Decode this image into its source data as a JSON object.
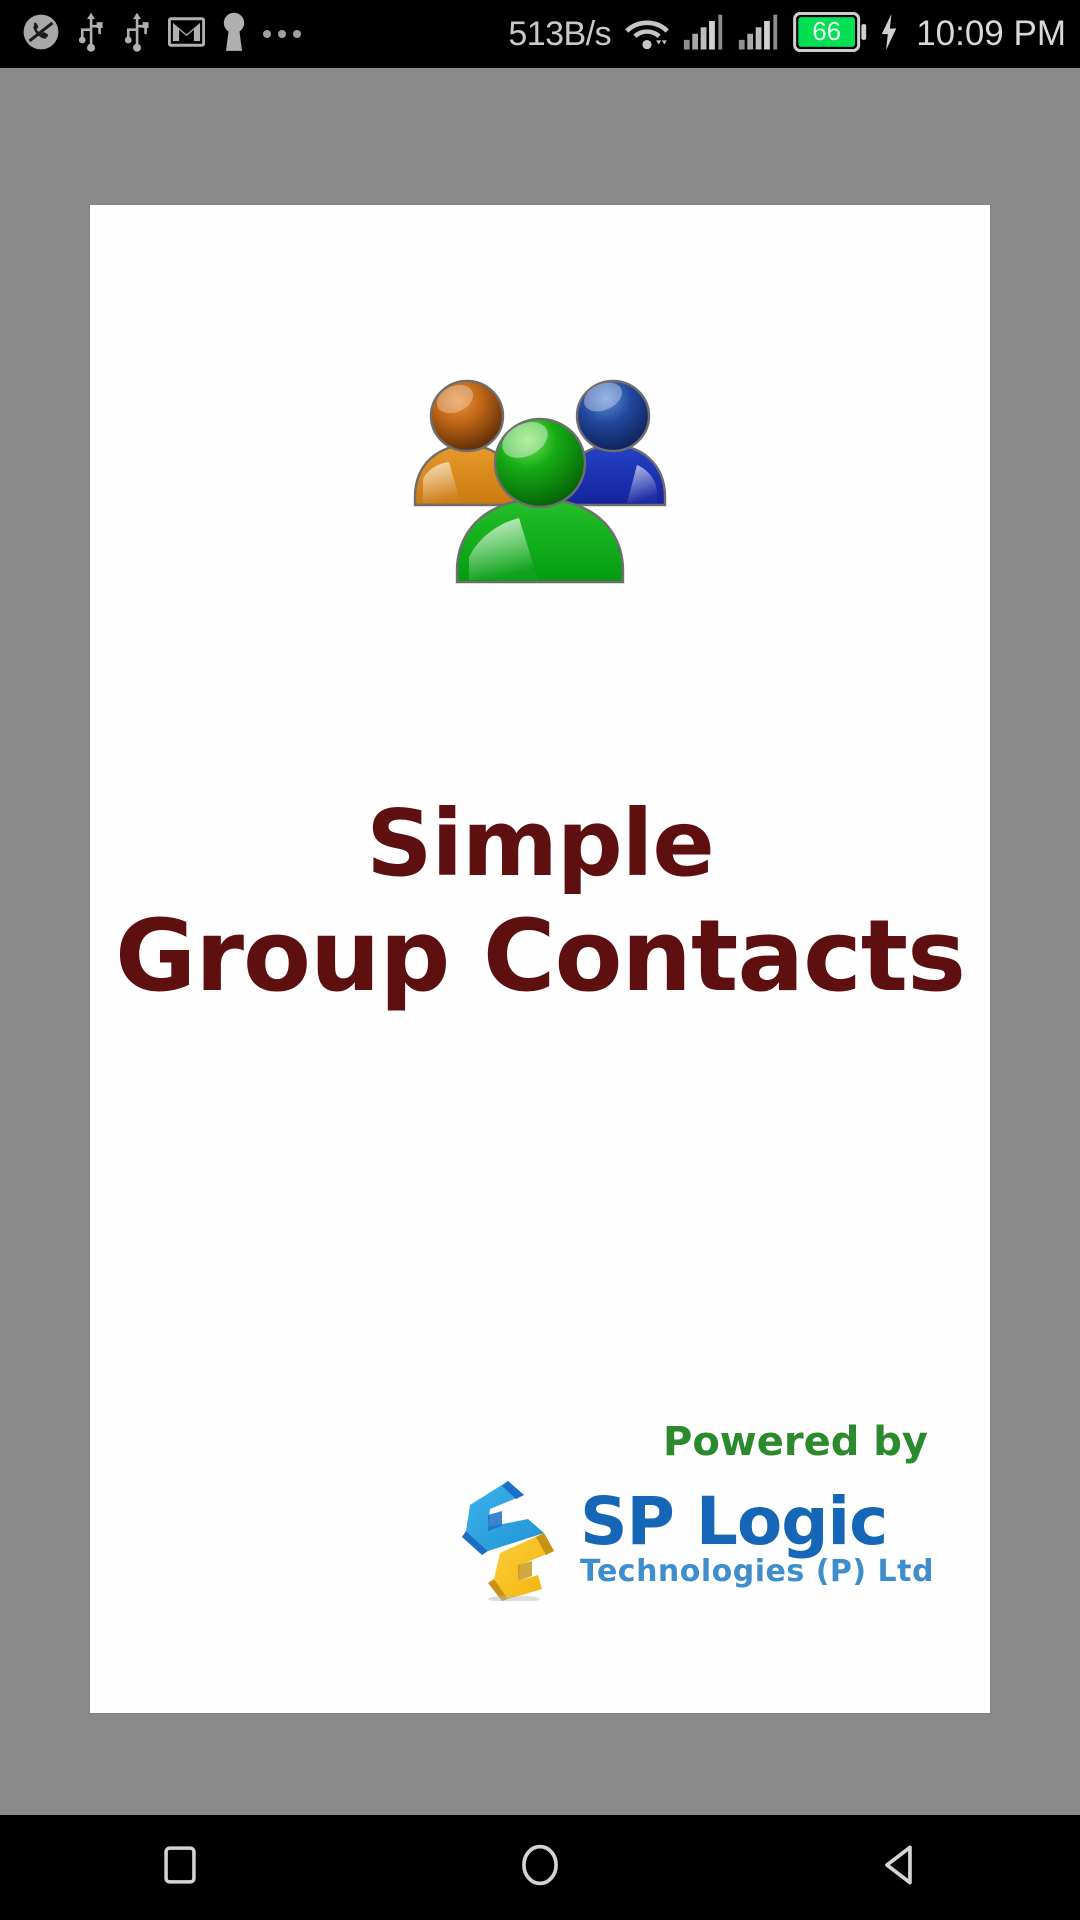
{
  "status_bar": {
    "left_icons": [
      {
        "name": "missed-call-icon",
        "label": "missed call"
      },
      {
        "name": "usb-icon",
        "label": "USB connected"
      },
      {
        "name": "usb-icon-2",
        "label": "USB debugging"
      },
      {
        "name": "gmail-icon",
        "label": "Gmail"
      },
      {
        "name": "keyhole-icon",
        "label": "secure"
      },
      {
        "name": "more-notifications-icon",
        "label": "more notifications"
      }
    ],
    "network_speed": "513B/s",
    "wifi_icon": "wifi-icon",
    "signal_1_icon": "signal-bars-icon",
    "signal_2_icon": "signal-bars-icon",
    "battery_level": "66",
    "battery_charging_icon": "charging-bolt-icon",
    "time": "10:09 PM",
    "background_color": "#000000",
    "text_color": "#d0d0d0",
    "battery_fill_color": "#00e052"
  },
  "splash": {
    "background_color": "#8a8a8a",
    "card_background_color": "#fefefe",
    "app_icon_name": "group-contacts-icon",
    "app_icon_colors": {
      "left_person": "#d2801a",
      "left_head": "#b35a12",
      "right_person": "#1b36b8",
      "right_head": "#2a4f9e",
      "center_person": "#10a81a",
      "center_head": "#17ab1c"
    },
    "title_line_1": "Simple",
    "title_line_2": "Group Contacts",
    "title_color": "#5e0f0f",
    "powered_by_label": "Powered by",
    "powered_by_color": "#2b8a2b",
    "vendor_name": "SP Logic",
    "vendor_tagline": "Technologies (P) Ltd",
    "vendor_name_color": "#1566b6",
    "vendor_tagline_color": "#3f8ecb",
    "vendor_mark_name": "sp-logic-mark-icon",
    "vendor_mark_colors": {
      "blue": "#2aa3e0",
      "blue_dark": "#1a6fc4",
      "yellow": "#f6c020",
      "yellow_dark": "#c79312"
    }
  },
  "nav_bar": {
    "background_color": "#000000",
    "icon_color": "#d4d4d4",
    "buttons": [
      {
        "name": "recents-button",
        "icon": "square-icon",
        "label": "Recents"
      },
      {
        "name": "home-button",
        "icon": "circle-icon",
        "label": "Home"
      },
      {
        "name": "back-button",
        "icon": "triangle-left-icon",
        "label": "Back"
      }
    ]
  }
}
